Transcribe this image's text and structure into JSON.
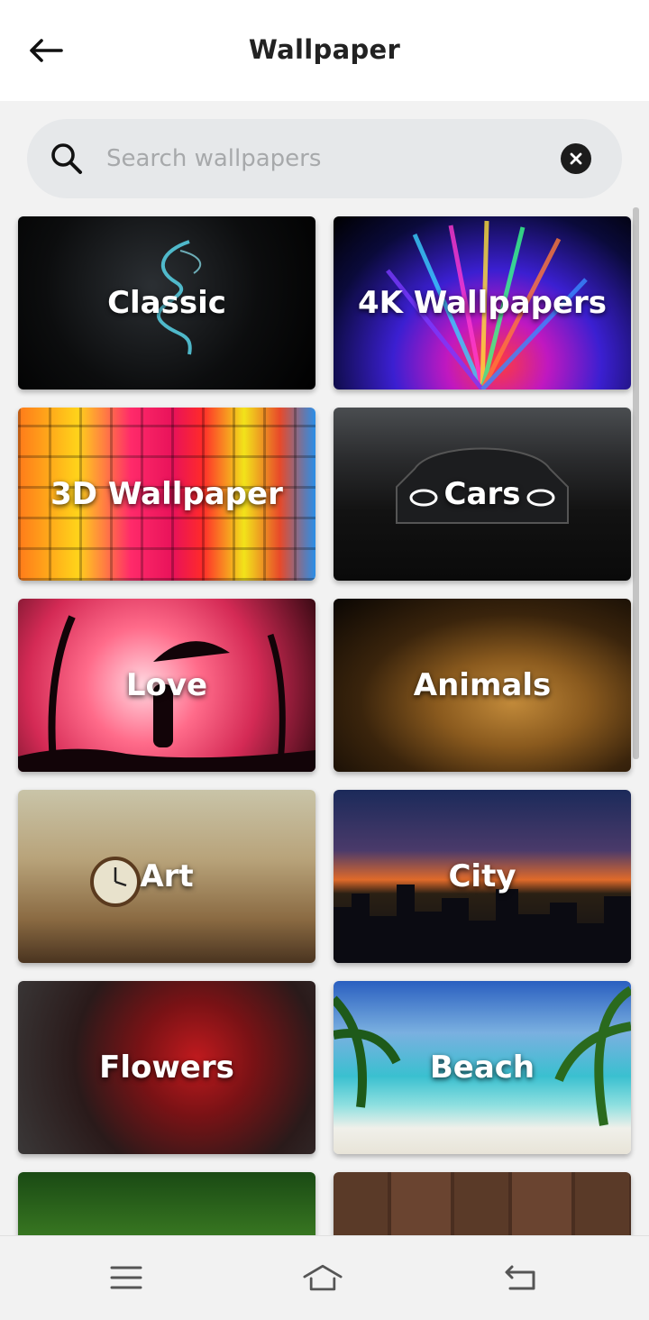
{
  "header": {
    "title": "Wallpaper"
  },
  "search": {
    "placeholder": "Search wallpapers",
    "value": ""
  },
  "categories": [
    {
      "label": "Classic"
    },
    {
      "label": "4K Wallpapers"
    },
    {
      "label": "3D Wallpaper"
    },
    {
      "label": "Cars"
    },
    {
      "label": "Love"
    },
    {
      "label": "Animals"
    },
    {
      "label": "Art"
    },
    {
      "label": "City"
    },
    {
      "label": "Flowers"
    },
    {
      "label": "Beach"
    },
    {
      "label": ""
    },
    {
      "label": ""
    }
  ],
  "icons": {
    "back": "back-arrow-icon",
    "search": "search-icon",
    "clear": "close-icon",
    "nav_menu": "menu-icon",
    "nav_home": "home-icon",
    "nav_back": "return-icon"
  },
  "colors": {
    "header_bg": "#ffffff",
    "page_bg": "#f2f2f2",
    "search_bg": "#e6e8ea",
    "text": "#222222"
  }
}
